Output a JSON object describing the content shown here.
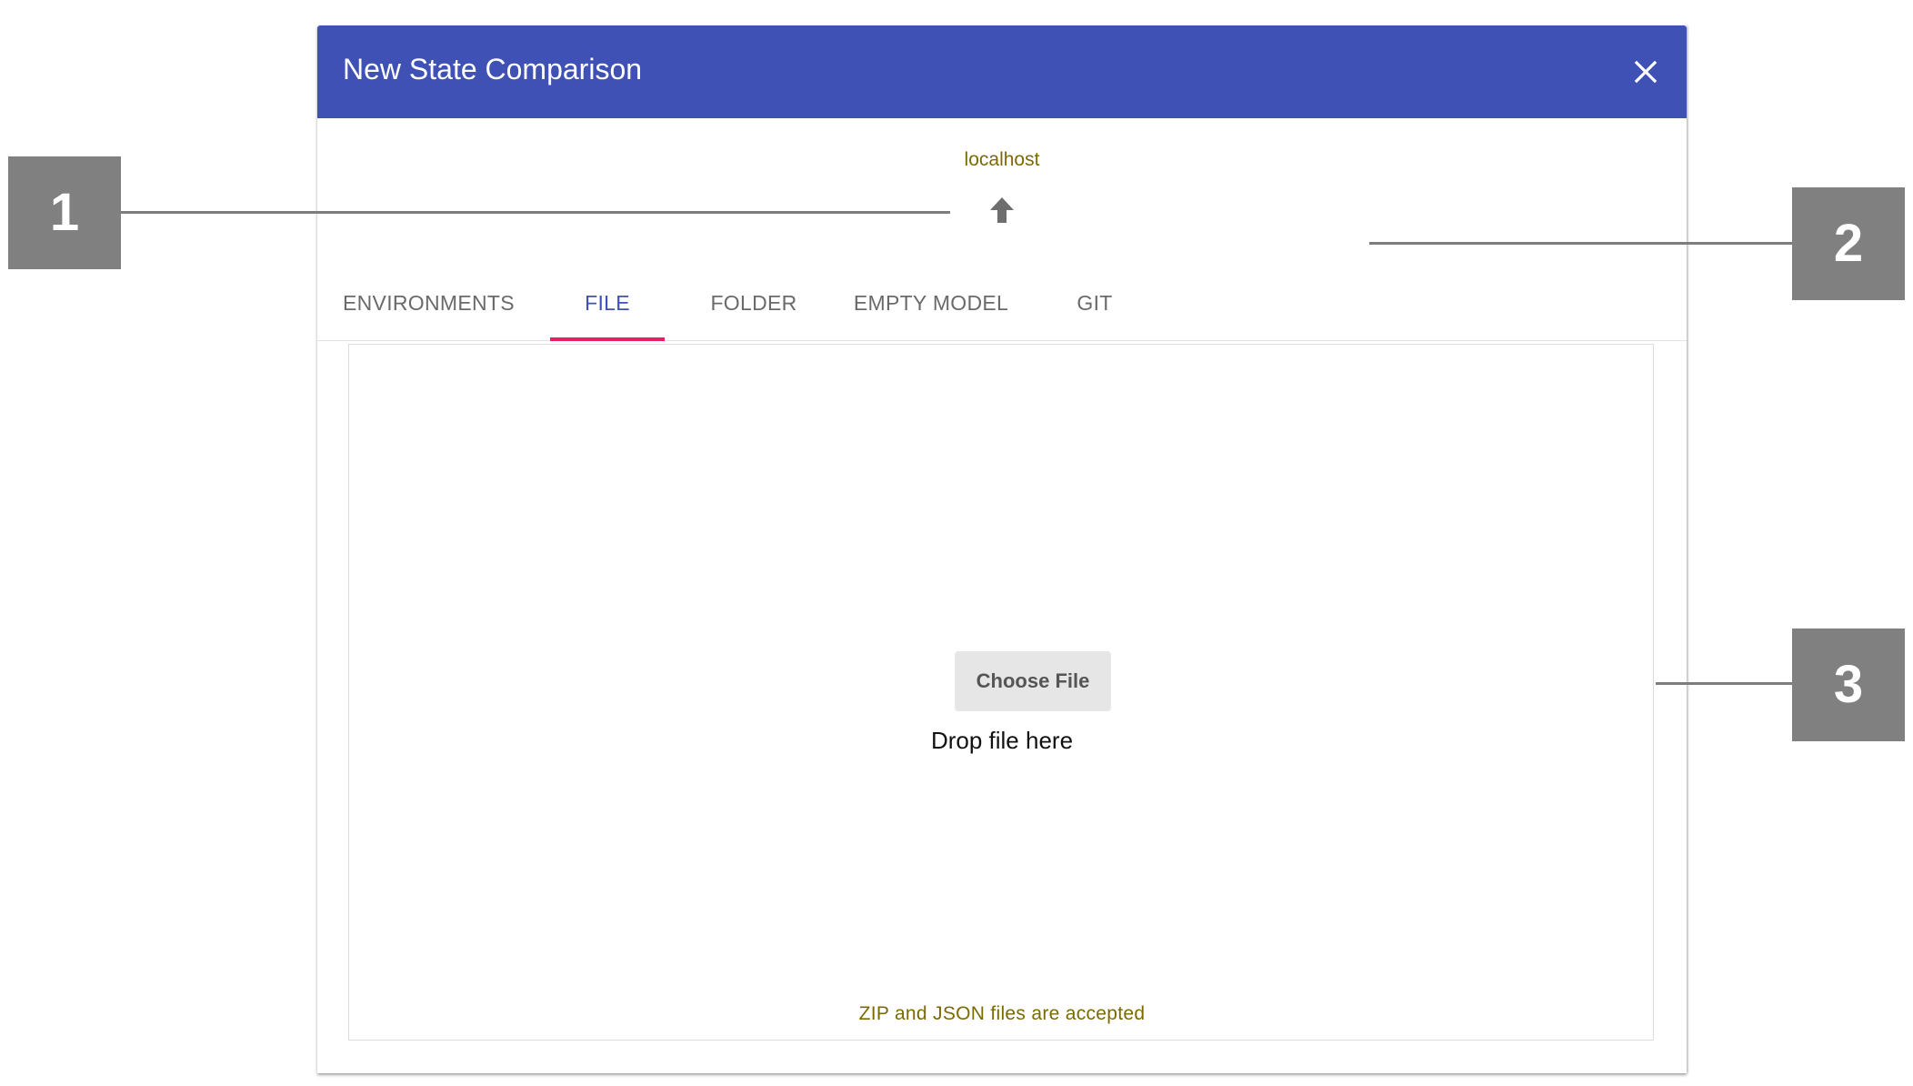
{
  "dialog": {
    "title": "New State Comparison",
    "host": "localhost",
    "tabs": [
      {
        "label": "ENVIRONMENTS",
        "active": false
      },
      {
        "label": "FILE",
        "active": true
      },
      {
        "label": "FOLDER",
        "active": false
      },
      {
        "label": "EMPTY MODEL",
        "active": false
      },
      {
        "label": "GIT",
        "active": false
      }
    ],
    "dropzone": {
      "button_label": "Choose File",
      "drop_text": "Drop file here",
      "accepted_note": "ZIP and JSON files are accepted"
    },
    "icons": {
      "close": "close-icon",
      "up": "arrow-up-icon"
    }
  },
  "callouts": [
    "1",
    "2",
    "3"
  ],
  "colors": {
    "header": "#3f51b5",
    "active_tab": "#3f51b5",
    "tab_indicator": "#e91e63",
    "hint_text": "#7b6a00",
    "callout": "#808080"
  }
}
